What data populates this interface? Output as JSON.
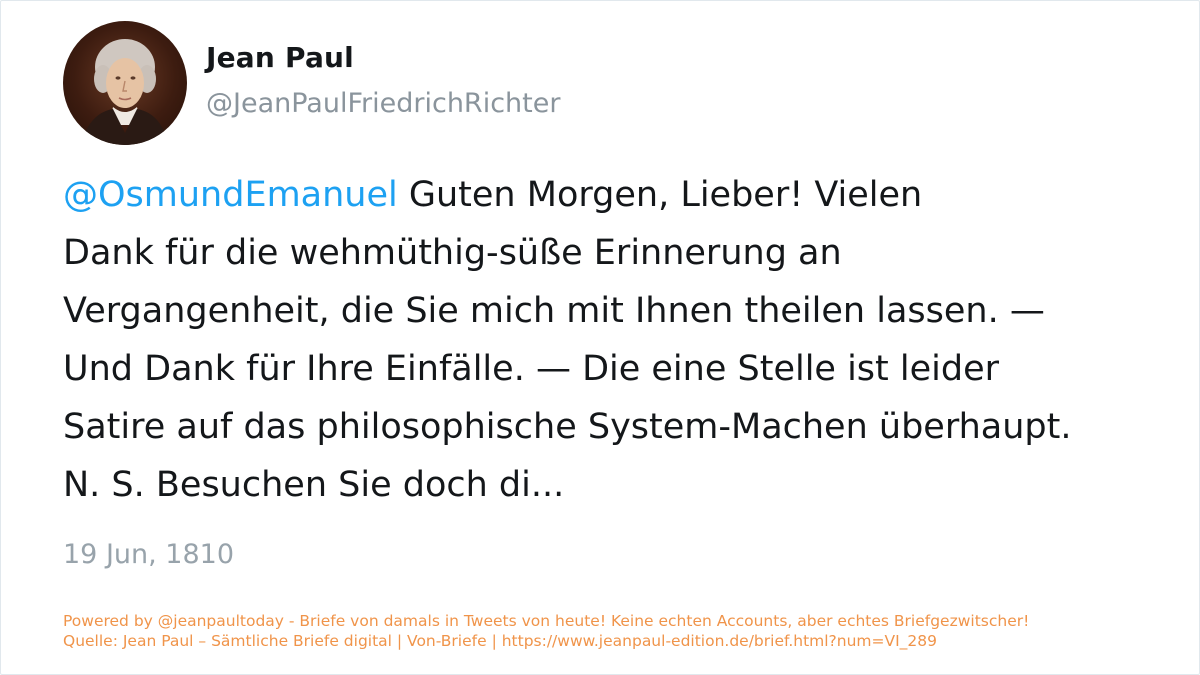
{
  "author": {
    "name": "Jean Paul",
    "handle": "@JeanPaulFriedrichRichter",
    "avatar_icon": "portrait-avatar-icon"
  },
  "tweet": {
    "mention": "@OsmundEmanuel",
    "line1_rest": " Guten Morgen, Lieber! Vielen",
    "lines": [
      "Dank für die wehmüthig-süße Erinnerung an",
      "Vergangenheit, die Sie mich mit Ihnen theilen lassen. —",
      "Und Dank für Ihre Einfälle. — Die eine Stelle ist leider",
      "Satire auf das philosophische System-Machen überhaupt.",
      "N. S. Besuchen Sie doch di..."
    ],
    "date": "19 Jun, 1810"
  },
  "footer": {
    "line1": "Powered by @jeanpaultoday - Briefe von damals in Tweets von heute! Keine echten Accounts, aber echtes Briefgezwitscher!",
    "line2": "Quelle: Jean Paul – Sämtliche Briefe digital | Von-Briefe | https://www.jeanpaul-edition.de/brief.html?num=VI_289"
  },
  "colors": {
    "mention": "#1da1f2",
    "text": "#14171a",
    "muted": "#8a949c",
    "footer": "#f0944a"
  }
}
